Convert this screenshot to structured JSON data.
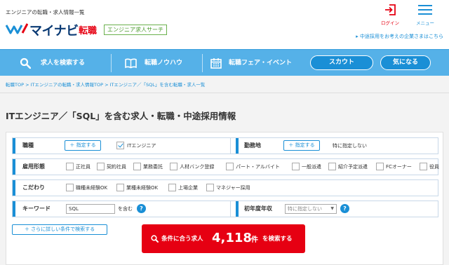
{
  "header": {
    "tagline": "エンジニアの転職・求人情報一覧",
    "logo_text": "マイナビ",
    "logo_sub": "転職",
    "engineer_badge": "エンジニア求人サーチ",
    "login_label": "ログイン",
    "menu_label": "メニュー",
    "corporate_link": "▸ 中途採用をお考えの企業さまはこちら"
  },
  "nav": {
    "items": [
      {
        "label": "求人を検索する",
        "icon": "search-icon"
      },
      {
        "label": "転職ノウハウ",
        "icon": "book-icon"
      },
      {
        "label": "転職フェア・イベント",
        "icon": "calendar-icon"
      }
    ],
    "scout_label": "スカウト",
    "favorite_label": "気になる"
  },
  "breadcrumb": {
    "items": [
      "転職TOP",
      "ITエンジニアの転職・求人情報TOP",
      "ITエンジニア／「SQL」を含む転職・求人一覧"
    ],
    "separator": " > "
  },
  "page_title": "ITエンジニア／「SQL」を含む求人・転職・中途採用情報",
  "form": {
    "job_type": {
      "label": "職種",
      "button": "＋ 指定する",
      "selected": "ITエンジニア"
    },
    "location": {
      "label": "勤務地",
      "button": "＋ 指定する",
      "value": "特に指定しない"
    },
    "employment": {
      "label": "雇用形態",
      "options": [
        "正社員",
        "契約社員",
        "業務委託",
        "人材バンク登録",
        "パート・アルバイト",
        "一般派遣",
        "紹介予定派遣",
        "FCオーナー",
        "役員"
      ]
    },
    "preferences": {
      "label": "こだわり",
      "options": [
        "職種未経験OK",
        "業種未経験OK",
        "上場企業",
        "マネジャー採用"
      ]
    },
    "keyword": {
      "label": "キーワード",
      "value": "SQL",
      "suffix": "を含む",
      "help": "?"
    },
    "grad_year": {
      "label": "初年度年収",
      "value": "特に指定しない",
      "help": "?"
    },
    "more_conditions": "＋ さらに詳しい条件で検索する",
    "search_button": {
      "prefix": "条件に合う求人",
      "count": "4,118",
      "unit": "件",
      "suffix": "を検索する"
    }
  },
  "colors": {
    "brand_blue": "#1a8fd6",
    "nav_blue": "#55b1e8",
    "accent_red": "#e60012",
    "badge_green": "#4a9a2c",
    "logo_navy": "#0a3a74"
  }
}
